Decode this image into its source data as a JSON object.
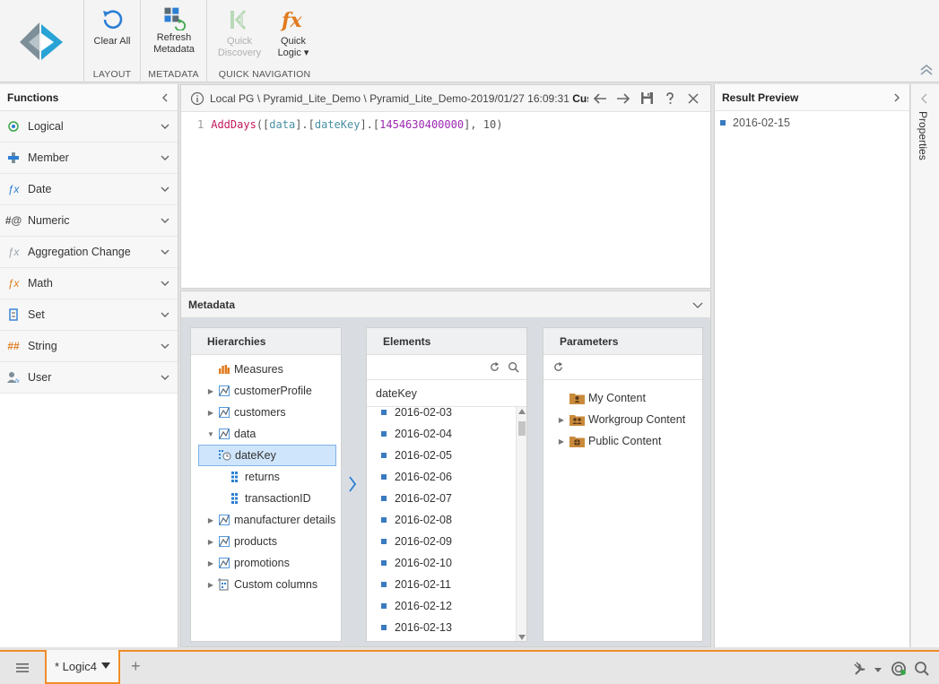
{
  "ribbon": {
    "buttons": {
      "clear_all": "Clear All",
      "refresh_metadata_line1": "Refresh",
      "refresh_metadata_line2": "Metadata",
      "quick_discovery_line1": "Quick",
      "quick_discovery_line2": "Discovery",
      "quick_logic_line1": "Quick",
      "quick_logic_line2": "Logic ▾"
    },
    "groups": {
      "layout": "LAYOUT",
      "metadata": "METADATA",
      "quick_navigation": "QUICK NAVIGATION"
    }
  },
  "functions": {
    "title": "Functions",
    "items": [
      {
        "label": "Logical",
        "icon": "logical-icon"
      },
      {
        "label": "Member",
        "icon": "member-icon"
      },
      {
        "label": "Date",
        "icon": "date-icon"
      },
      {
        "label": "Numeric",
        "icon": "numeric-icon"
      },
      {
        "label": "Aggregation Change",
        "icon": "aggregation-icon"
      },
      {
        "label": "Math",
        "icon": "math-icon"
      },
      {
        "label": "Set",
        "icon": "set-icon"
      },
      {
        "label": "String",
        "icon": "string-icon"
      },
      {
        "label": "User",
        "icon": "user-icon"
      }
    ]
  },
  "editor": {
    "path": "Local PG \\ Pyramid_Lite_Demo \\ Pyramid_Lite_Demo-2019/01/27 16:09:31",
    "path_suffix": "Cus...",
    "line_number": "1",
    "code": {
      "fn": "AddDays",
      "open": "(",
      "b1": "[",
      "id1": "data",
      "b2": "].[",
      "id2": "dateKey",
      "b3": "].[",
      "num": "1454630400000",
      "b4": "], ",
      "num2": "10",
      "close": ")"
    }
  },
  "metadata": {
    "title": "Metadata",
    "hierarchies": {
      "title": "Hierarchies",
      "items": [
        {
          "label": "Measures",
          "icon": "measures-icon",
          "indent": 1,
          "arrow": ""
        },
        {
          "label": "customerProfile",
          "icon": "hierarchy-icon",
          "indent": 0,
          "arrow": "▶"
        },
        {
          "label": "customers",
          "icon": "hierarchy-icon",
          "indent": 0,
          "arrow": "▶"
        },
        {
          "label": "data",
          "icon": "hierarchy-icon",
          "indent": 0,
          "arrow": "▼"
        },
        {
          "label": "dateKey",
          "icon": "date-attribute-icon",
          "indent": 2,
          "arrow": "",
          "selected": true
        },
        {
          "label": "returns",
          "icon": "attribute-icon",
          "indent": 2,
          "arrow": ""
        },
        {
          "label": "transactionID",
          "icon": "attribute-icon",
          "indent": 2,
          "arrow": ""
        },
        {
          "label": "manufacturer details",
          "icon": "hierarchy-icon",
          "indent": 0,
          "arrow": "▶"
        },
        {
          "label": "products",
          "icon": "hierarchy-icon",
          "indent": 0,
          "arrow": "▶"
        },
        {
          "label": "promotions",
          "icon": "hierarchy-icon",
          "indent": 0,
          "arrow": "▶"
        },
        {
          "label": "Custom columns",
          "icon": "custom-columns-icon",
          "indent": 0,
          "arrow": "▶"
        }
      ]
    },
    "elements": {
      "title": "Elements",
      "field": "dateKey",
      "items": [
        "2016-02-03",
        "2016-02-04",
        "2016-02-05",
        "2016-02-06",
        "2016-02-07",
        "2016-02-08",
        "2016-02-09",
        "2016-02-10",
        "2016-02-11",
        "2016-02-12",
        "2016-02-13"
      ]
    },
    "parameters": {
      "title": "Parameters",
      "items": [
        {
          "label": "My Content",
          "arrow": ""
        },
        {
          "label": "Workgroup Content",
          "arrow": "▶"
        },
        {
          "label": "Public Content",
          "arrow": "▶"
        }
      ]
    }
  },
  "result_preview": {
    "title": "Result Preview",
    "items": [
      "2016-02-15"
    ]
  },
  "properties": {
    "label": "Properties"
  },
  "bottom_bar": {
    "tab_label": "* Logic4",
    "add_tab": "+"
  },
  "colors": {
    "accent": "#f28c28",
    "selection": "#cfe5fb",
    "bullet": "#3a7bbf"
  }
}
